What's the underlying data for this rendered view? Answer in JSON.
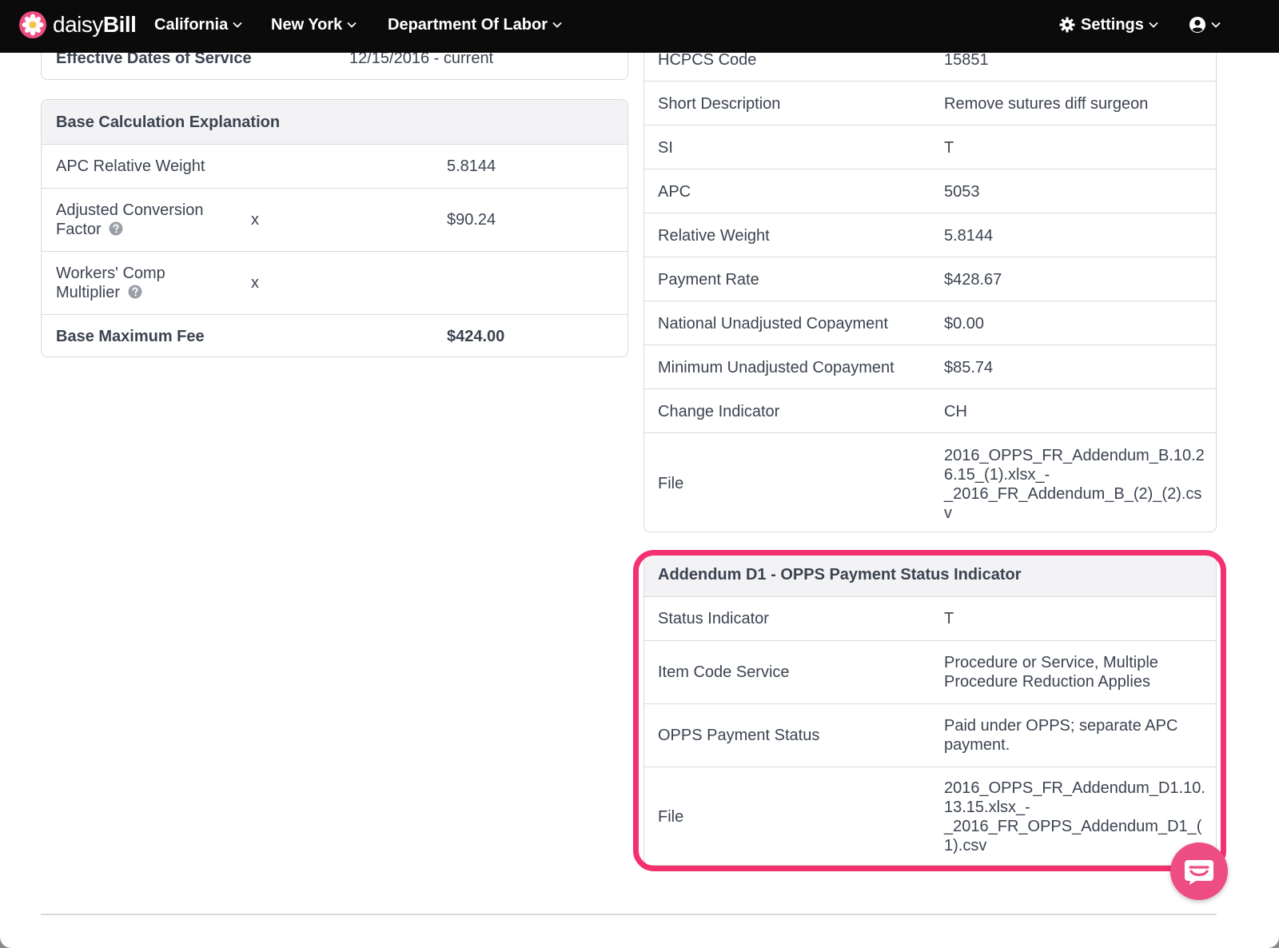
{
  "nav": {
    "logo_light": "daisy",
    "logo_bold": "Bill",
    "menus": [
      "California",
      "New York",
      "Department Of Labor"
    ],
    "settings_label": "Settings"
  },
  "left_top": {
    "label": "Effective Dates of Service",
    "value": "12/15/2016 - current"
  },
  "base_calc": {
    "title": "Base Calculation Explanation",
    "rows": [
      {
        "label": "APC Relative Weight",
        "op": "",
        "value": "5.8144"
      },
      {
        "label_line1": "Adjusted Conversion",
        "label_line2": "Factor",
        "op": "x",
        "value": "$90.24"
      },
      {
        "label_line1": "Workers' Comp",
        "label_line2": "Multiplier",
        "op": "x",
        "value": ""
      },
      {
        "label": "Base Maximum Fee",
        "op": "",
        "value": "$424.00"
      }
    ]
  },
  "right_top": {
    "rows": [
      {
        "label": "HCPCS Code",
        "value": "15851"
      },
      {
        "label": "Short Description",
        "value": "Remove sutures diff surgeon"
      },
      {
        "label": "SI",
        "value": "T"
      },
      {
        "label": "APC",
        "value": "5053"
      },
      {
        "label": "Relative Weight",
        "value": "5.8144"
      },
      {
        "label": "Payment Rate",
        "value": "$428.67"
      },
      {
        "label": "National Unadjusted Copayment",
        "value": "$0.00"
      },
      {
        "label": "Minimum Unadjusted Copayment",
        "value": "$85.74"
      },
      {
        "label": "Change Indicator",
        "value": "CH"
      },
      {
        "label": "File",
        "value_lines": [
          "2016_OPPS_FR_Addendum_B.10.2",
          "6.15_(1).xlsx_-",
          "_2016_FR_Addendum_B_(2)_(2).cs",
          "v"
        ]
      }
    ]
  },
  "addendum": {
    "title": "Addendum D1 - OPPS Payment Status Indicator",
    "rows": [
      {
        "label": "Status Indicator",
        "value_lines": [
          "T"
        ]
      },
      {
        "label": "Item Code Service",
        "value_lines": [
          "Procedure or Service, Multiple",
          "Procedure Reduction Applies"
        ]
      },
      {
        "label": "OPPS Payment Status",
        "value_lines": [
          "Paid under OPPS; separate APC",
          "payment."
        ]
      },
      {
        "label": "File",
        "value_lines": [
          "2016_OPPS_FR_Addendum_D1.10.",
          "13.15.xlsx_-",
          "_2016_FR_OPPS_Addendum_D1_(",
          "1).csv"
        ]
      }
    ]
  },
  "colors": {
    "navbar": "#0b0b0b",
    "highlight": "#f5306f",
    "chat": "#ee4d84",
    "header_row": "#f3f3f5"
  }
}
